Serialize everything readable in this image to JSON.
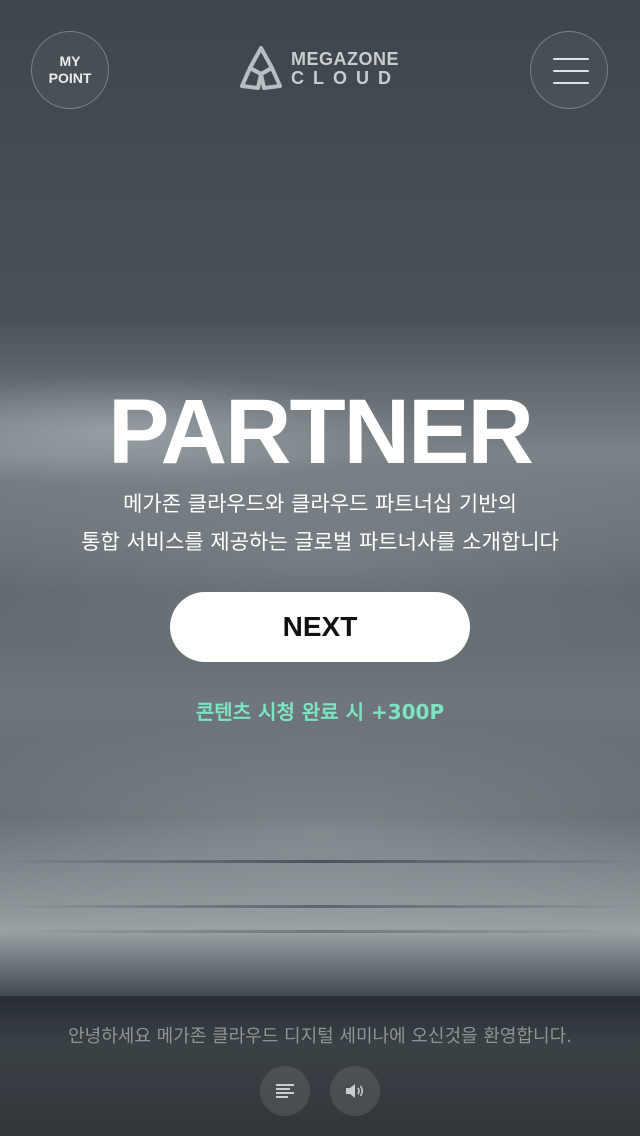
{
  "header": {
    "my_point_label": "MY\nPOINT",
    "logo_line1": "MEGAZONE",
    "logo_line2": "CLOUD",
    "menu_icon": "hamburger-menu-icon",
    "logo_icon": "megazone-cloud-logo"
  },
  "hero": {
    "title": "PARTNER",
    "subtitle_line1": "메가존 클라우드와 클라우드 파트너십 기반의",
    "subtitle_line2": "통합 서비스를 제공하는 글로벌 파트너사를 소개합니다",
    "next_label": "NEXT",
    "reward_text": "콘텐츠 시청 완료 시 +300P"
  },
  "footer": {
    "greeting": "안녕하세요 메가존 클라우드 디지털 세미나에 오신것을 환영합니다.",
    "controls": [
      {
        "icon": "text-lines-icon"
      },
      {
        "icon": "speaker-icon"
      }
    ]
  },
  "colors": {
    "accent_reward": "#7de3c4",
    "button_bg": "#ffffff",
    "overlay": "#1c2024"
  }
}
